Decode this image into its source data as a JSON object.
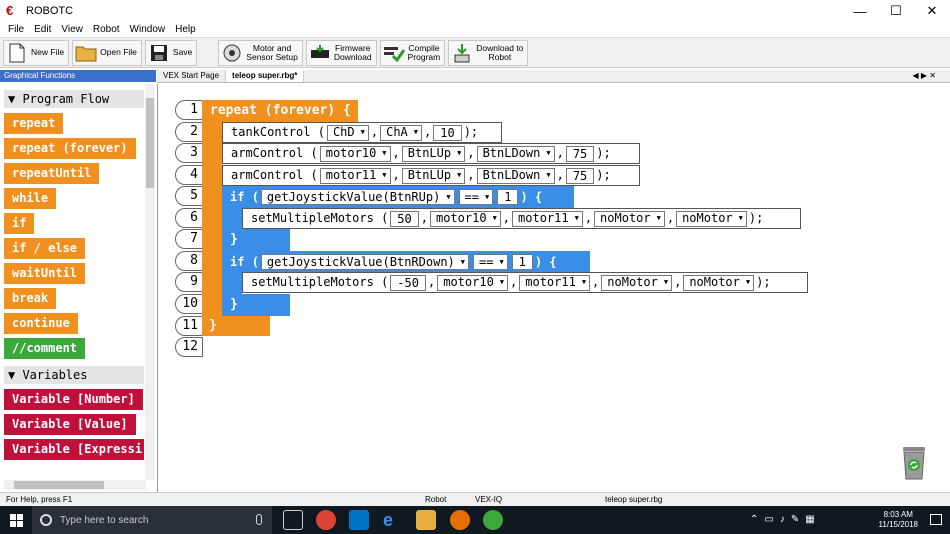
{
  "window": {
    "title": "ROBOTC",
    "minimize": "—",
    "maximize": "☐",
    "close": "✕"
  },
  "menu": [
    "File",
    "Edit",
    "View",
    "Robot",
    "Window",
    "Help"
  ],
  "toolbar": {
    "new_file": "New File",
    "open_file": "Open File",
    "save": "Save",
    "motor_setup": [
      "Motor and",
      "Sensor Setup"
    ],
    "firmware": [
      "Firmware",
      "Download"
    ],
    "compile": [
      "Compile",
      "Program"
    ],
    "download": [
      "Download to",
      "Robot"
    ]
  },
  "left_panel": {
    "title": "Graphical Functions",
    "sections": {
      "program_flow": "▼ Program Flow",
      "variables": "▼ Variables"
    },
    "flow_blocks": [
      "repeat",
      "repeat (forever)",
      "repeatUntil",
      "while",
      "if",
      "if / else",
      "waitUntil",
      "break",
      "continue",
      "//comment"
    ],
    "variable_blocks": [
      "Variable [Number]",
      "Variable [Value]",
      "Variable [Expressi"
    ]
  },
  "tabs": {
    "start": "VEX Start Page",
    "active": "teleop super.rbg*",
    "nav": "◀ ▶ ✕"
  },
  "code": {
    "line_numbers": [
      "1",
      "2",
      "3",
      "4",
      "5",
      "6",
      "7",
      "8",
      "9",
      "10",
      "11",
      "12"
    ],
    "repeat_kw": "repeat (forever) {",
    "close_brace": "}",
    "open_brace": "{",
    "paren_open": "(",
    "paren_close": ")",
    "paren_semi": ");",
    "comma": ",",
    "tank": {
      "fn": "tankControl",
      "a": "ChD",
      "b": "ChA",
      "n": "10"
    },
    "arm1": {
      "fn": "armControl",
      "a": "motor10",
      "b": "BtnLUp",
      "c": "BtnLDown",
      "n": "75"
    },
    "arm2": {
      "fn": "armControl",
      "a": "motor11",
      "b": "BtnLUp",
      "c": "BtnLDown",
      "n": "75"
    },
    "if1": {
      "kw": "if",
      "cond": "getJoystickValue(BtnRUp)",
      "op": "==",
      "val": "1"
    },
    "set1": {
      "fn": "setMultipleMotors",
      "n": "50",
      "a": "motor10",
      "b": "motor11",
      "c": "noMotor",
      "d": "noMotor"
    },
    "if2": {
      "kw": "if",
      "cond": "getJoystickValue(BtnRDown)",
      "op": "==",
      "val": "1"
    },
    "set2": {
      "fn": "setMultipleMotors",
      "n": "-50",
      "a": "motor10",
      "b": "motor11",
      "c": "noMotor",
      "d": "noMotor"
    }
  },
  "status": {
    "help": "For Help, press F1",
    "robot": "Robot",
    "platform": "VEX-IQ",
    "file": "teleop super.rbg"
  },
  "taskbar": {
    "search_placeholder": "Type here to search",
    "time": "8:03 AM",
    "date": "11/15/2018"
  },
  "colors": {
    "orange": "#f0901e",
    "blue": "#3b8ee8",
    "green": "#3aa83a",
    "red": "#c0103c"
  }
}
